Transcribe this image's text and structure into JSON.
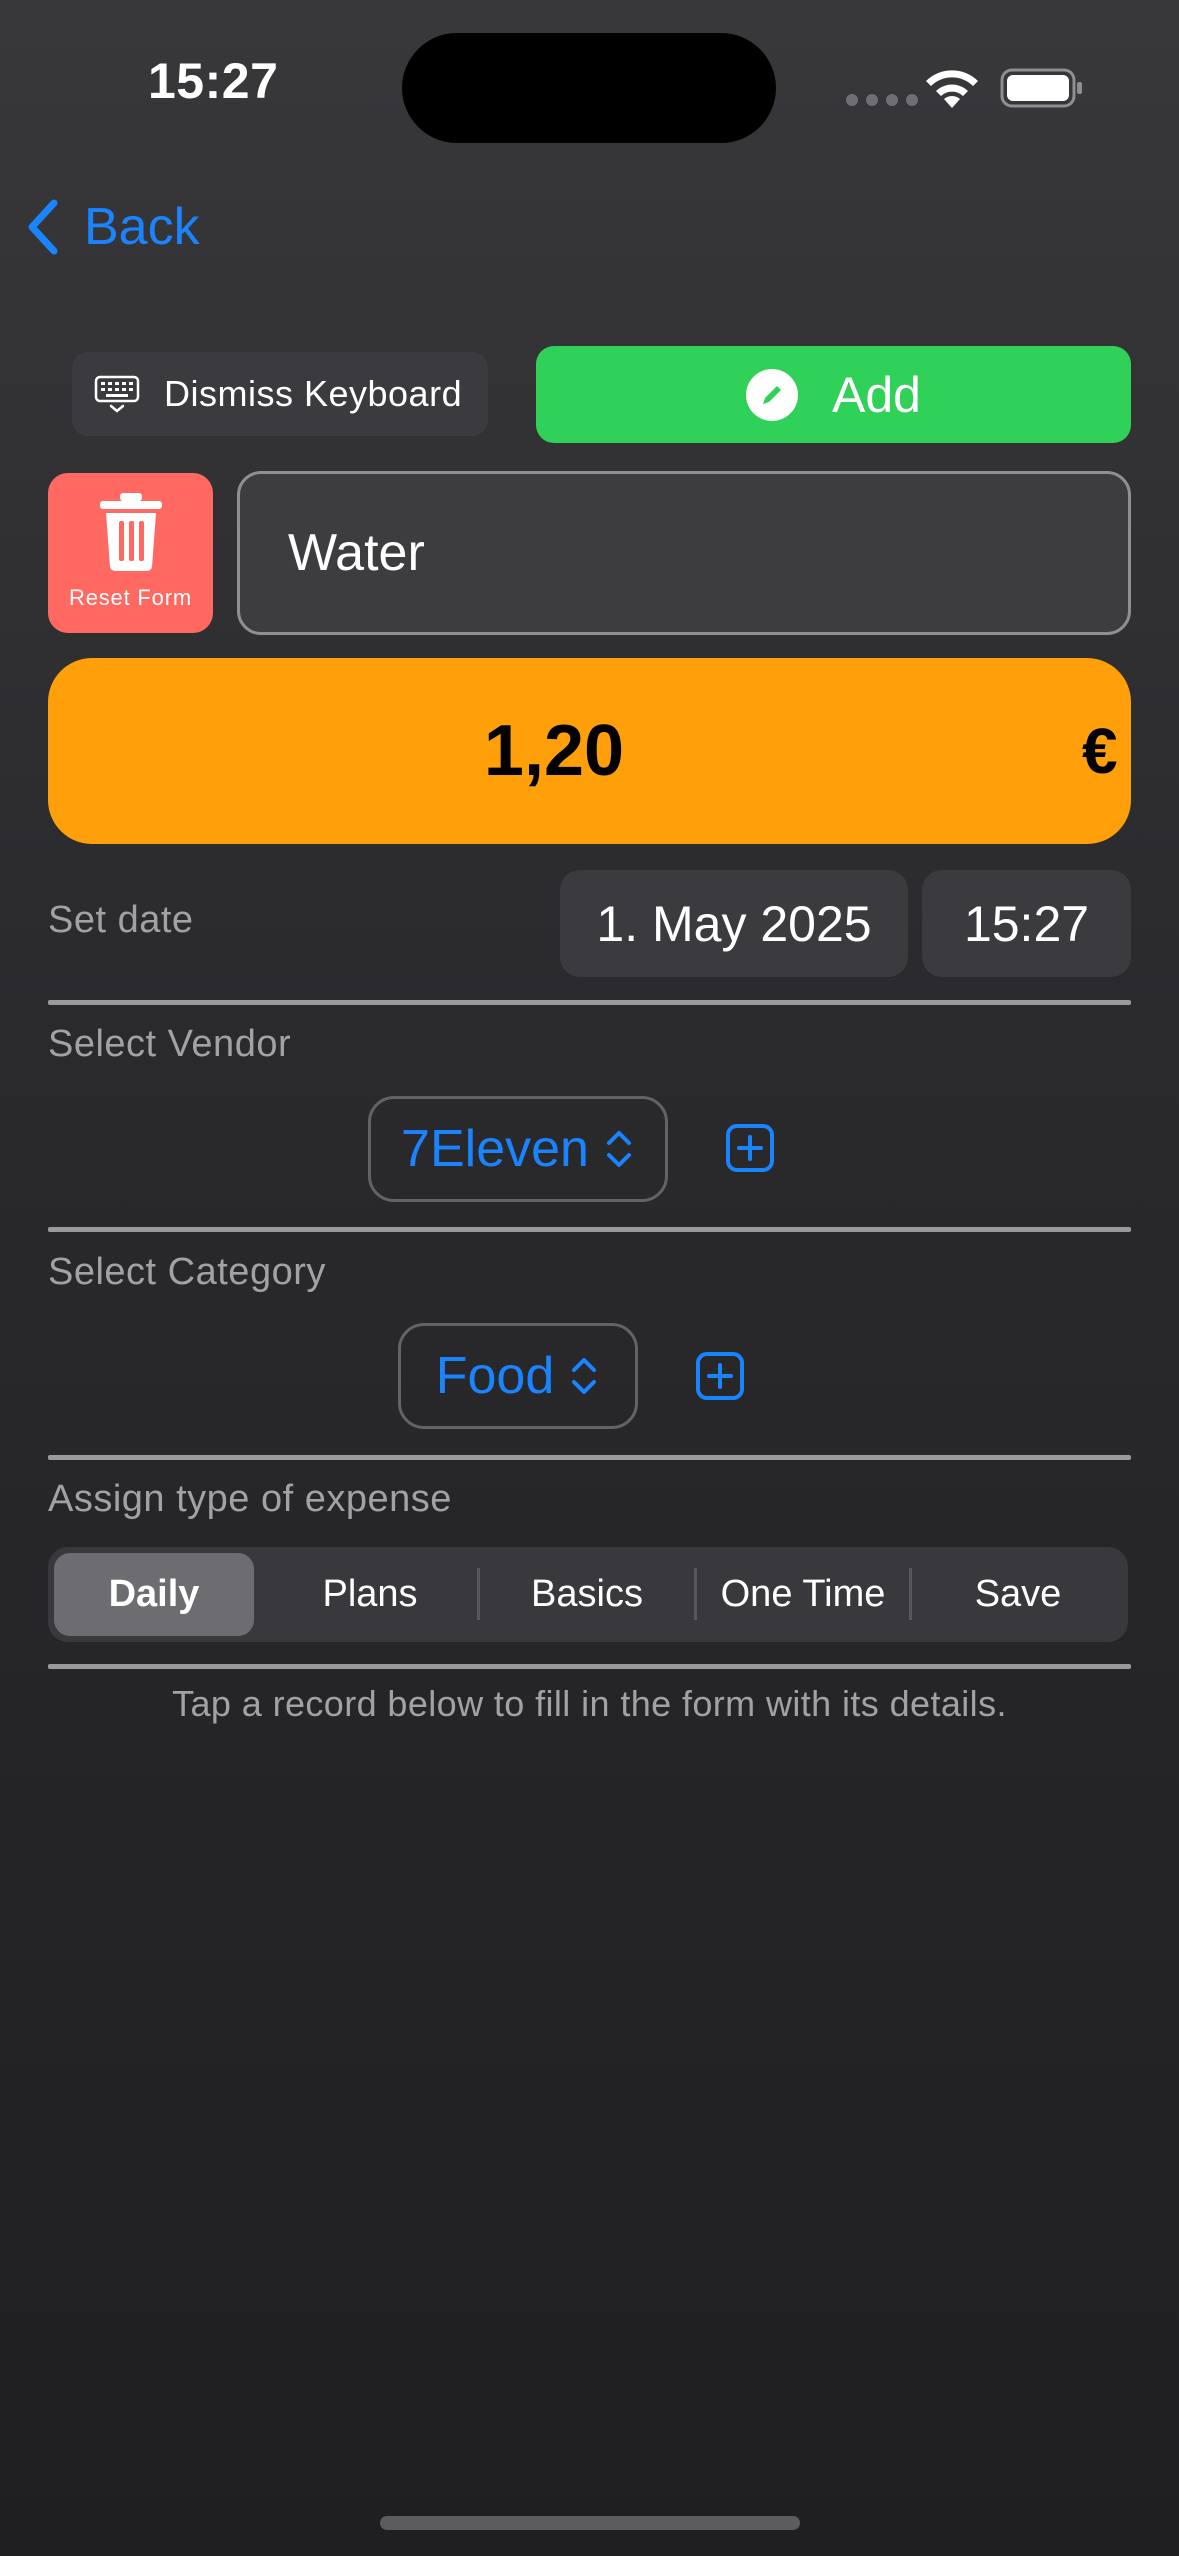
{
  "status_bar": {
    "time": "15:27"
  },
  "nav": {
    "back_label": "Back"
  },
  "toolbar": {
    "dismiss_label": "Dismiss Keyboard",
    "add_label": "Add"
  },
  "reset": {
    "label": "Reset Form"
  },
  "form": {
    "name_value": "Water",
    "amount": "1,20",
    "currency": "€",
    "date_label": "Set date",
    "date_value": "1. May 2025",
    "time_value": "15:27",
    "vendor_label": "Select Vendor",
    "vendor_value": "7Eleven",
    "category_label": "Select Category",
    "category_value": "Food",
    "expense_type_label": "Assign type of expense",
    "expense_types": [
      "Daily",
      "Plans",
      "Basics",
      "One Time",
      "Save"
    ],
    "selected_expense_type": "Daily"
  },
  "hint": "Tap a record below to fill in the form with its details.",
  "colors": {
    "accent_blue": "#1a84ff",
    "add_green": "#30d158",
    "reset_red": "#ff6961",
    "amount_orange": "#ff9f0a"
  }
}
